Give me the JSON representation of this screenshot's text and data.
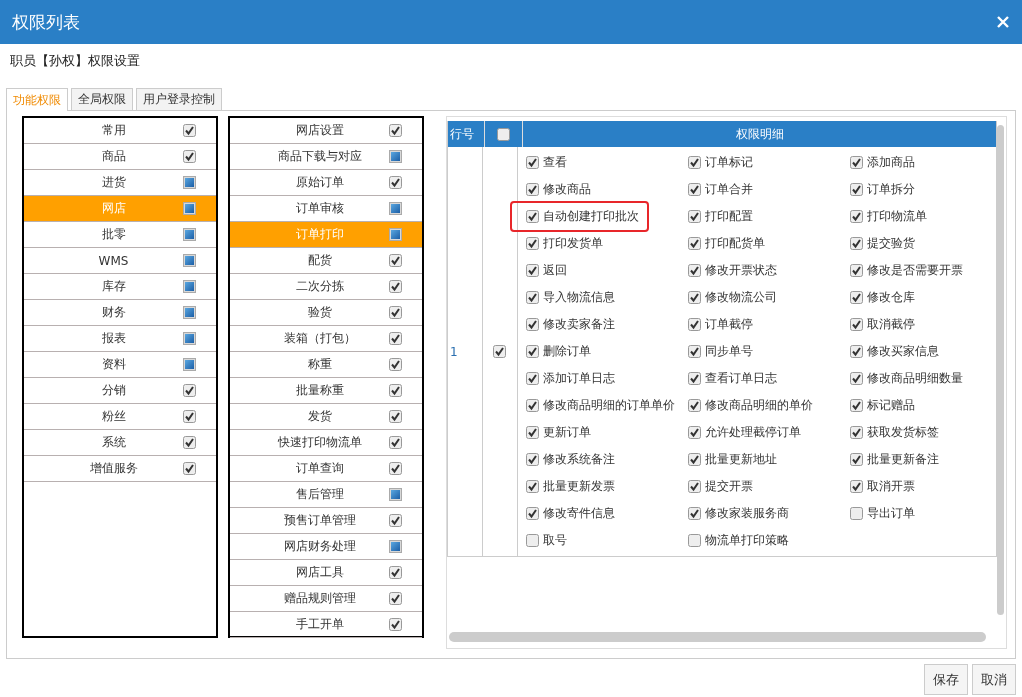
{
  "dialog": {
    "title": "权限列表"
  },
  "subtitle": "职员【孙权】权限设置",
  "tabs": [
    {
      "label": "功能权限",
      "selected": true
    },
    {
      "label": "全局权限",
      "selected": false
    },
    {
      "label": "用户登录控制",
      "selected": false
    }
  ],
  "modules": [
    {
      "label": "常用",
      "selected": false,
      "checked": true,
      "indeterminate": false
    },
    {
      "label": "商品",
      "selected": false,
      "checked": true,
      "indeterminate": false
    },
    {
      "label": "进货",
      "selected": false,
      "checked": false,
      "indeterminate": true
    },
    {
      "label": "网店",
      "selected": true,
      "checked": false,
      "indeterminate": true
    },
    {
      "label": "批零",
      "selected": false,
      "checked": false,
      "indeterminate": true
    },
    {
      "label": "WMS",
      "selected": false,
      "checked": false,
      "indeterminate": true
    },
    {
      "label": "库存",
      "selected": false,
      "checked": false,
      "indeterminate": true
    },
    {
      "label": "财务",
      "selected": false,
      "checked": false,
      "indeterminate": true
    },
    {
      "label": "报表",
      "selected": false,
      "checked": false,
      "indeterminate": true
    },
    {
      "label": "资料",
      "selected": false,
      "checked": false,
      "indeterminate": true
    },
    {
      "label": "分销",
      "selected": false,
      "checked": true,
      "indeterminate": false
    },
    {
      "label": "粉丝",
      "selected": false,
      "checked": true,
      "indeterminate": false
    },
    {
      "label": "系统",
      "selected": false,
      "checked": true,
      "indeterminate": false
    },
    {
      "label": "增值服务",
      "selected": false,
      "checked": true,
      "indeterminate": false
    }
  ],
  "submodules": [
    {
      "label": "网店设置",
      "selected": false,
      "checked": true,
      "indeterminate": false
    },
    {
      "label": "商品下载与对应",
      "selected": false,
      "checked": false,
      "indeterminate": true
    },
    {
      "label": "原始订单",
      "selected": false,
      "checked": true,
      "indeterminate": false
    },
    {
      "label": "订单审核",
      "selected": false,
      "checked": false,
      "indeterminate": true
    },
    {
      "label": "订单打印",
      "selected": true,
      "checked": false,
      "indeterminate": true
    },
    {
      "label": "配货",
      "selected": false,
      "checked": true,
      "indeterminate": false
    },
    {
      "label": "二次分拣",
      "selected": false,
      "checked": true,
      "indeterminate": false
    },
    {
      "label": "验货",
      "selected": false,
      "checked": true,
      "indeterminate": false
    },
    {
      "label": "装箱（打包）",
      "selected": false,
      "checked": true,
      "indeterminate": false
    },
    {
      "label": "称重",
      "selected": false,
      "checked": true,
      "indeterminate": false
    },
    {
      "label": "批量称重",
      "selected": false,
      "checked": true,
      "indeterminate": false
    },
    {
      "label": "发货",
      "selected": false,
      "checked": true,
      "indeterminate": false
    },
    {
      "label": "快速打印物流单",
      "selected": false,
      "checked": true,
      "indeterminate": false
    },
    {
      "label": "订单查询",
      "selected": false,
      "checked": true,
      "indeterminate": false
    },
    {
      "label": "售后管理",
      "selected": false,
      "checked": false,
      "indeterminate": true
    },
    {
      "label": "预售订单管理",
      "selected": false,
      "checked": true,
      "indeterminate": false
    },
    {
      "label": "网店财务处理",
      "selected": false,
      "checked": false,
      "indeterminate": true
    },
    {
      "label": "网店工具",
      "selected": false,
      "checked": true,
      "indeterminate": false
    },
    {
      "label": "赠品规则管理",
      "selected": false,
      "checked": true,
      "indeterminate": false
    },
    {
      "label": "手工开单",
      "selected": false,
      "checked": true,
      "indeterminate": false
    }
  ],
  "table": {
    "columns": [
      "行号",
      "权限明细"
    ],
    "header_checked": false,
    "rows": [
      {
        "number": "1",
        "checked": true,
        "permissions": [
          {
            "label": "查看",
            "checked": true,
            "highlighted": false
          },
          {
            "label": "订单标记",
            "checked": true,
            "highlighted": false
          },
          {
            "label": "添加商品",
            "checked": true,
            "highlighted": false
          },
          {
            "label": "修改商品",
            "checked": true,
            "highlighted": false
          },
          {
            "label": "订单合并",
            "checked": true,
            "highlighted": false
          },
          {
            "label": "订单拆分",
            "checked": true,
            "highlighted": false
          },
          {
            "label": "自动创建打印批次",
            "checked": true,
            "highlighted": true
          },
          {
            "label": "打印配置",
            "checked": true,
            "highlighted": false
          },
          {
            "label": "打印物流单",
            "checked": true,
            "highlighted": false
          },
          {
            "label": "打印发货单",
            "checked": true,
            "highlighted": false
          },
          {
            "label": "打印配货单",
            "checked": true,
            "highlighted": false
          },
          {
            "label": "提交验货",
            "checked": true,
            "highlighted": false
          },
          {
            "label": "返回",
            "checked": true,
            "highlighted": false
          },
          {
            "label": "修改开票状态",
            "checked": true,
            "highlighted": false
          },
          {
            "label": "修改是否需要开票",
            "checked": true,
            "highlighted": false
          },
          {
            "label": "导入物流信息",
            "checked": true,
            "highlighted": false
          },
          {
            "label": "修改物流公司",
            "checked": true,
            "highlighted": false
          },
          {
            "label": "修改仓库",
            "checked": true,
            "highlighted": false
          },
          {
            "label": "修改卖家备注",
            "checked": true,
            "highlighted": false
          },
          {
            "label": "订单截停",
            "checked": true,
            "highlighted": false
          },
          {
            "label": "取消截停",
            "checked": true,
            "highlighted": false
          },
          {
            "label": "删除订单",
            "checked": true,
            "highlighted": false
          },
          {
            "label": "同步单号",
            "checked": true,
            "highlighted": false
          },
          {
            "label": "修改买家信息",
            "checked": true,
            "highlighted": false
          },
          {
            "label": "添加订单日志",
            "checked": true,
            "highlighted": false
          },
          {
            "label": "查看订单日志",
            "checked": true,
            "highlighted": false
          },
          {
            "label": "修改商品明细数量",
            "checked": true,
            "highlighted": false
          },
          {
            "label": "修改商品明细的订单单价",
            "checked": true,
            "highlighted": false
          },
          {
            "label": "修改商品明细的单价",
            "checked": true,
            "highlighted": false
          },
          {
            "label": "标记赠品",
            "checked": true,
            "highlighted": false
          },
          {
            "label": "更新订单",
            "checked": true,
            "highlighted": false
          },
          {
            "label": "允许处理截停订单",
            "checked": true,
            "highlighted": false
          },
          {
            "label": "获取发货标签",
            "checked": true,
            "highlighted": false
          },
          {
            "label": "修改系统备注",
            "checked": true,
            "highlighted": false
          },
          {
            "label": "批量更新地址",
            "checked": true,
            "highlighted": false
          },
          {
            "label": "批量更新备注",
            "checked": true,
            "highlighted": false
          },
          {
            "label": "批量更新发票",
            "checked": true,
            "highlighted": false
          },
          {
            "label": "提交开票",
            "checked": true,
            "highlighted": false
          },
          {
            "label": "取消开票",
            "checked": true,
            "highlighted": false
          },
          {
            "label": "修改寄件信息",
            "checked": true,
            "highlighted": false
          },
          {
            "label": "修改家装服务商",
            "checked": true,
            "highlighted": false
          },
          {
            "label": "导出订单",
            "checked": false,
            "highlighted": false
          },
          {
            "label": "取号",
            "checked": false,
            "highlighted": false
          },
          {
            "label": "物流单打印策略",
            "checked": false,
            "highlighted": false
          }
        ]
      }
    ]
  },
  "buttons": [
    "保存",
    "取消"
  ]
}
